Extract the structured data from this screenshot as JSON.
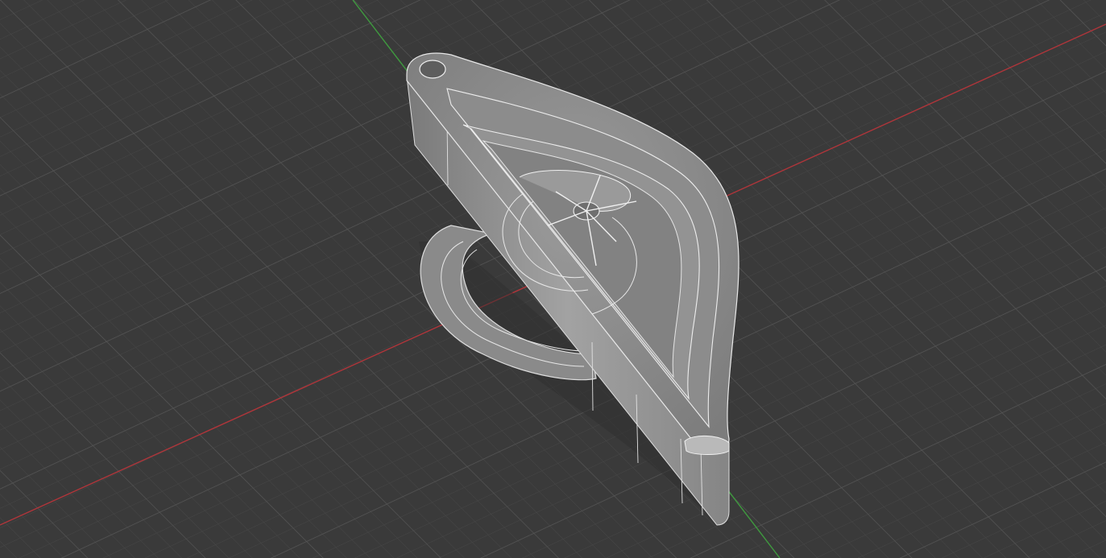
{
  "viewport": {
    "background": "#3a3a3a",
    "grid_minor_color": "#474747",
    "grid_major_color": "#545454",
    "x_axis_color": "#b0353a",
    "y_axis_color": "#3f9a3f",
    "display_mode": "shaded-with-edges"
  },
  "model": {
    "shape": "teardrop keychain pendant with hanging hole, concentric raised rims and central star-spoked emblem",
    "body_color": "#8d8d8d",
    "top_color": "#a3a3a3",
    "edge_color": "#e6e6e6",
    "shadow_color": "#4a4a4a"
  }
}
